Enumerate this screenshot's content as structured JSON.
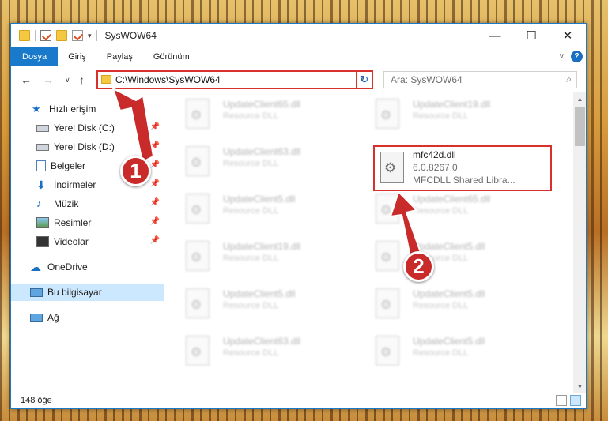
{
  "window": {
    "title": "SysWOW64",
    "controls": {
      "minimize": "—",
      "maximize": "☐",
      "close": "✕"
    }
  },
  "ribbon": {
    "tabs": [
      "Dosya",
      "Giriş",
      "Paylaş",
      "Görünüm"
    ]
  },
  "address": {
    "path": "C:\\Windows\\SysWOW64"
  },
  "search": {
    "placeholder": "Ara: SysWOW64"
  },
  "sidebar": {
    "items": [
      {
        "label": "Hızlı erişim",
        "icon": "star-icon",
        "pinned": false
      },
      {
        "label": "Yerel Disk (C:)",
        "icon": "drive-icon",
        "pinned": true
      },
      {
        "label": "Yerel Disk (D:)",
        "icon": "drive-icon",
        "pinned": true
      },
      {
        "label": "Belgeler",
        "icon": "documents-icon",
        "pinned": true
      },
      {
        "label": "İndirmeler",
        "icon": "download-icon",
        "pinned": true
      },
      {
        "label": "Müzik",
        "icon": "music-icon",
        "pinned": true
      },
      {
        "label": "Resimler",
        "icon": "pictures-icon",
        "pinned": true
      },
      {
        "label": "Videolar",
        "icon": "videos-icon",
        "pinned": true
      },
      {
        "label": "OneDrive",
        "icon": "cloud-icon",
        "pinned": false
      },
      {
        "label": "Bu bilgisayar",
        "icon": "computer-icon",
        "pinned": false
      },
      {
        "label": "Ağ",
        "icon": "network-icon",
        "pinned": false
      }
    ]
  },
  "files": [
    {
      "name": "UpdateClient65.dll",
      "desc": "Resource DLL"
    },
    {
      "name": "UpdateClient19.dll",
      "desc": "Resource DLL"
    },
    {
      "name": "UpdateClient63.dll",
      "desc": "Resource DLL"
    },
    {
      "name": "UpdateClient5.dll",
      "desc": "Resource DLL"
    },
    {
      "name": "UpdateClient65.dll",
      "desc": "Resource DLL"
    },
    {
      "name": "UpdateClient19.dll",
      "desc": "Resource DLL"
    },
    {
      "name": "UpdateClient5.dll",
      "desc": "Resource DLL"
    },
    {
      "name": "UpdateClient5.dll",
      "desc": "Resource DLL"
    },
    {
      "name": "UpdateClient5.dll",
      "desc": "Resource DLL"
    },
    {
      "name": "UpdateClient63.dll",
      "desc": "Resource DLL"
    },
    {
      "name": "UpdateClient5.dll",
      "desc": "Resource DLL"
    }
  ],
  "highlighted_file": {
    "name": "mfc42d.dll",
    "version": "6.0.8267.0",
    "description": "MFCDLL Shared Libra..."
  },
  "status": {
    "count": "148 öğe"
  },
  "callouts": {
    "one": "1",
    "two": "2"
  },
  "colors": {
    "accent": "#1979ca",
    "highlight_border": "#d8312b",
    "badge": "#c92a2a"
  }
}
